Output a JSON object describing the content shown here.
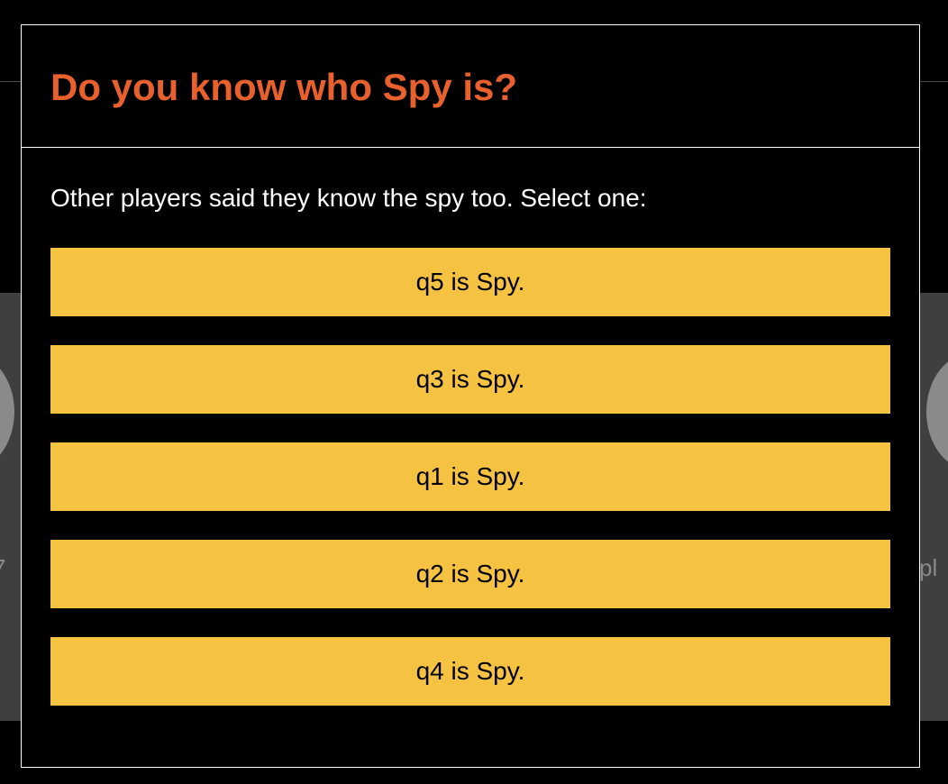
{
  "background": {
    "left_text": "7",
    "right_text": "pl"
  },
  "modal": {
    "title": "Do you know who Spy is?",
    "prompt": "Other players said they know the spy too. Select one:",
    "options": [
      {
        "label": "q5 is Spy."
      },
      {
        "label": "q3 is Spy."
      },
      {
        "label": "q1 is Spy."
      },
      {
        "label": "q2 is Spy."
      },
      {
        "label": "q4 is Spy."
      }
    ]
  },
  "colors": {
    "title": "#e8602c",
    "button": "#f5c242",
    "background": "#000000",
    "border": "#ffffff"
  }
}
